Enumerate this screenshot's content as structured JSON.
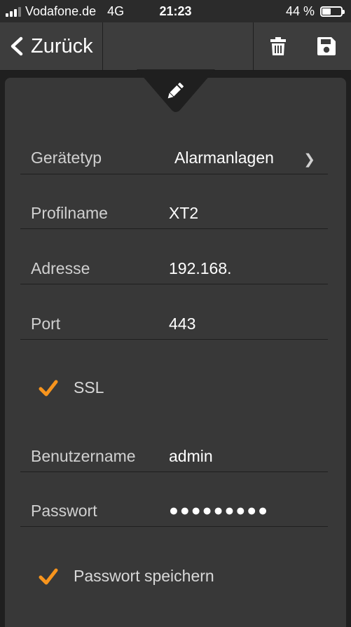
{
  "status_bar": {
    "carrier": "Vodafone.de",
    "network": "4G",
    "time": "21:23",
    "battery_text": "44 %",
    "battery_level": 0.44,
    "signal_bars_filled": 3,
    "signal_bars_total": 4
  },
  "toolbar": {
    "back_label": "Zurück",
    "delete_icon": "trash-icon",
    "save_icon": "floppy-disk-icon"
  },
  "panel": {
    "edit_icon": "pencil-icon"
  },
  "form": {
    "device_type": {
      "label": "Gerätetyp",
      "value": "Alarmanlagen",
      "chevron": "❯"
    },
    "profile_name": {
      "label": "Profilname",
      "value": "XT2"
    },
    "address": {
      "label": "Adresse",
      "value": "192.168."
    },
    "port": {
      "label": "Port",
      "value": "443"
    },
    "ssl": {
      "label": "SSL",
      "checked": true
    },
    "username": {
      "label": "Benutzername",
      "value": "admin"
    },
    "password": {
      "label": "Passwort",
      "value": "●●●●●●●●●"
    },
    "save_password": {
      "label": "Passwort speichern",
      "checked": true
    }
  },
  "colors": {
    "accent": "#f7941d",
    "toolbar_bg": "#3d3d3d",
    "panel_bg": "#383838",
    "app_bg": "#1f1f1f"
  }
}
